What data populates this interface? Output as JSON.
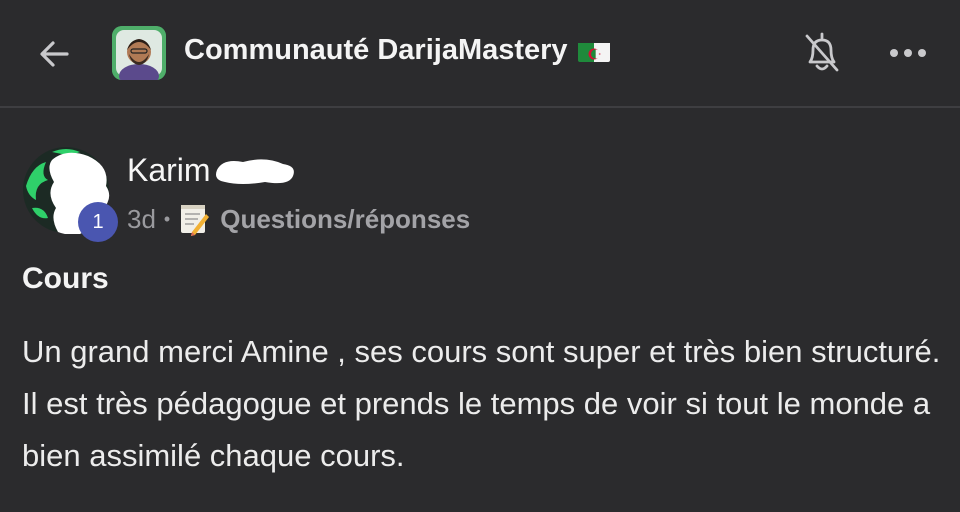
{
  "header": {
    "back_icon": "arrow-left-icon",
    "community_name": "Communauté DarijaMastery",
    "flag_icon": "algeria-flag-icon",
    "bell_icon": "bell-icon",
    "more_icon": "more-horizontal-icon"
  },
  "post": {
    "author_name": "Karim",
    "level": "1",
    "time_ago": "3d",
    "separator": "•",
    "category_icon": "memo-icon",
    "category": "Questions/réponses",
    "title": "Cours",
    "body": "Un grand merci Amine , ses cours sont super et très bien structuré. Il est très pédagogue et prends le temps de voir si tout le monde a bien assimilé chaque cours."
  },
  "colors": {
    "background": "#2b2b2d",
    "level_badge": "#4a56b0",
    "meta_text": "#9a9a9e"
  }
}
